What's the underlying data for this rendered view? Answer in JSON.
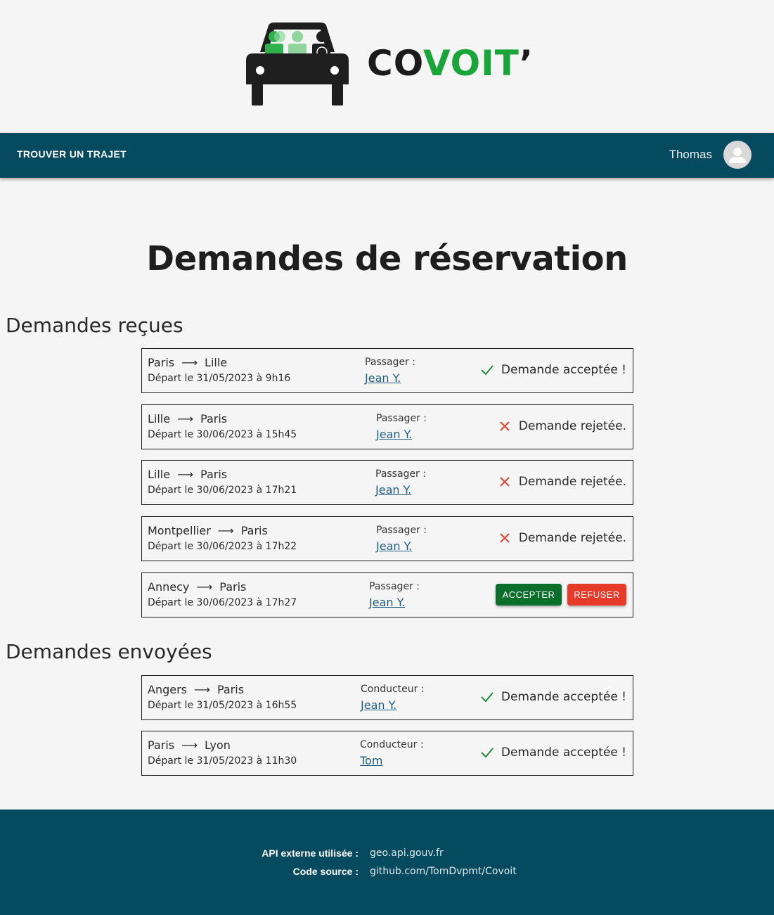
{
  "brand": {
    "name_part1": "CO",
    "name_part2": "VOIT",
    "name_part3": "’"
  },
  "nav": {
    "find_trip": "TROUVER UN TRAJET",
    "user_name": "Thomas"
  },
  "page": {
    "title": "Demandes de réservation"
  },
  "received": {
    "section_title": "Demandes reçues",
    "items": [
      {
        "from": "Paris",
        "to": "Lille",
        "departure": "Départ le 31/05/2023 à 9h16",
        "role": "Passager :",
        "person": "Jean Y.",
        "status": "Demande acceptée !",
        "state": "accepted"
      },
      {
        "from": "Lille",
        "to": "Paris",
        "departure": "Départ le 30/06/2023 à 15h45",
        "role": "Passager :",
        "person": "Jean Y.",
        "status": "Demande rejetée.",
        "state": "rejected"
      },
      {
        "from": "Lille",
        "to": "Paris",
        "departure": "Départ le 30/06/2023 à 17h21",
        "role": "Passager :",
        "person": "Jean Y.",
        "status": "Demande rejetée.",
        "state": "rejected"
      },
      {
        "from": "Montpellier",
        "to": "Paris",
        "departure": "Départ le 30/06/2023 à 17h22",
        "role": "Passager :",
        "person": "Jean Y.",
        "status": "Demande rejetée.",
        "state": "rejected"
      },
      {
        "from": "Annecy",
        "to": "Paris",
        "departure": "Départ le 30/06/2023 à 17h27",
        "role": "Passager :",
        "person": "Jean Y.",
        "accept_label": "ACCEPTER",
        "refuse_label": "REFUSER",
        "state": "pending"
      }
    ]
  },
  "sent": {
    "section_title": "Demandes envoyées",
    "items": [
      {
        "from": "Angers",
        "to": "Paris",
        "departure": "Départ le 31/05/2023 à 16h55",
        "role": "Conducteur :",
        "person": "Jean Y.",
        "status": "Demande acceptée !",
        "state": "accepted"
      },
      {
        "from": "Paris",
        "to": "Lyon",
        "departure": "Départ le 31/05/2023 à 11h30",
        "role": "Conducteur :",
        "person": "Tom",
        "status": "Demande acceptée !",
        "state": "accepted"
      }
    ]
  },
  "footer": {
    "api_label": "API externe utilisée :",
    "api_value": "geo.api.gouv.fr",
    "source_label": "Code source :",
    "source_value": "github.com/TomDvpmt/Covoit"
  },
  "colors": {
    "primary": "#054a5e",
    "brand_green": "#19a538",
    "accept_button": "#0a6f2a",
    "refuse_button": "#e73b29",
    "link": "#1f5d80",
    "check": "#1f8a3a",
    "cross": "#e0442f"
  }
}
